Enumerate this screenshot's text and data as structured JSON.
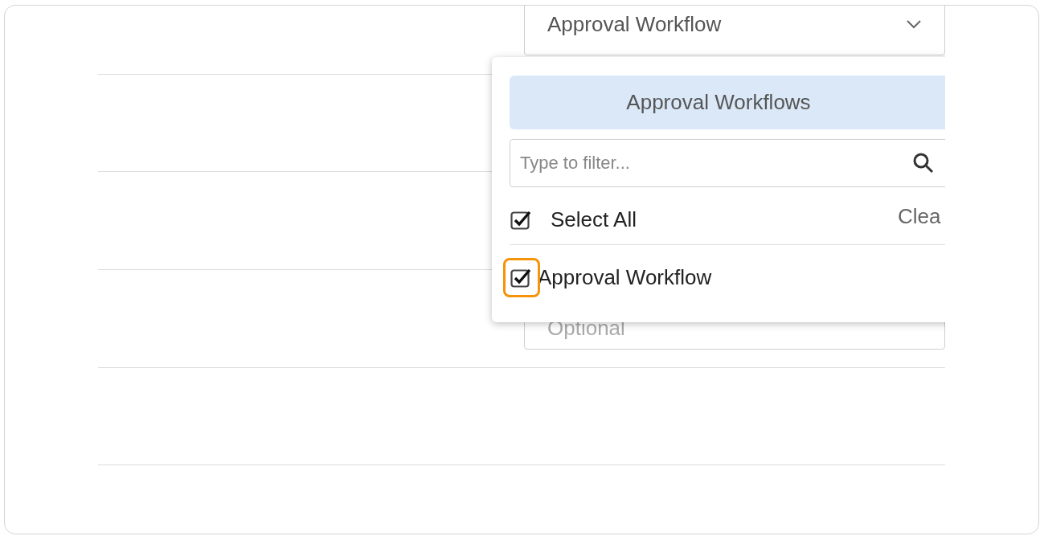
{
  "rows": [
    {
      "field": {
        "value": "Approval Workflow",
        "kind": "dropdown"
      }
    },
    {},
    {},
    {
      "field": {
        "placeholder": "Optional",
        "kind": "text"
      }
    },
    {}
  ],
  "popup": {
    "title": "Approval Workflows",
    "filter": {
      "placeholder": "Type to filter..."
    },
    "select_all": {
      "label": "Select All",
      "checked": true
    },
    "clear": "Clea",
    "items": [
      {
        "label": "Approval Workflow",
        "checked": true,
        "highlighted": true
      }
    ]
  }
}
